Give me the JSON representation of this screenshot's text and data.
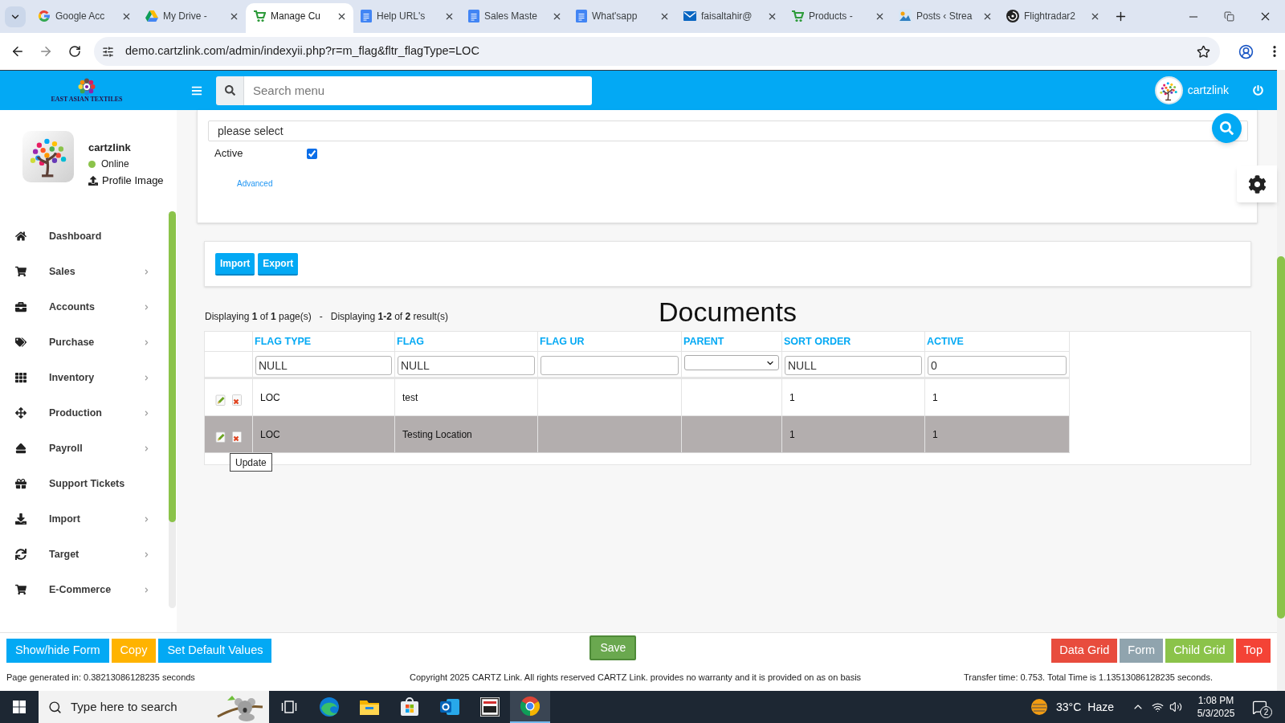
{
  "browser": {
    "tabs": [
      {
        "title": "Google Acc",
        "selected": false
      },
      {
        "title": "My Drive -",
        "selected": false
      },
      {
        "title": "Manage Cu",
        "selected": true
      },
      {
        "title": "Help URL's",
        "selected": false
      },
      {
        "title": "Sales Maste",
        "selected": false
      },
      {
        "title": "What'sapp",
        "selected": false
      },
      {
        "title": "faisaltahir@",
        "selected": false
      },
      {
        "title": "Products -",
        "selected": false
      },
      {
        "title": "Posts ‹ Strea",
        "selected": false
      },
      {
        "title": "Flightradar2",
        "selected": false
      }
    ],
    "address": "demo.cartzlink.com/admin/indexyii.php?r=m_flag&fltr_flagType=LOC"
  },
  "header": {
    "logo_caption": "EAST ASIAN TEXTILES",
    "search": {
      "placeholder": "Search menu"
    },
    "user": "cartzlink"
  },
  "sidebar": {
    "profile": {
      "name": "cartzlink",
      "status": "Online",
      "upload": "Profile Image"
    },
    "items": [
      {
        "label": "Dashboard",
        "has_submenu": false
      },
      {
        "label": "Sales",
        "has_submenu": true
      },
      {
        "label": "Accounts",
        "has_submenu": true
      },
      {
        "label": "Purchase",
        "has_submenu": true
      },
      {
        "label": "Inventory",
        "has_submenu": true
      },
      {
        "label": "Production",
        "has_submenu": true
      },
      {
        "label": "Payroll",
        "has_submenu": true
      },
      {
        "label": "Support Tickets",
        "has_submenu": false
      },
      {
        "label": "Import",
        "has_submenu": true
      },
      {
        "label": "Target",
        "has_submenu": true
      },
      {
        "label": "E-Commerce",
        "has_submenu": true
      }
    ]
  },
  "form": {
    "select": {
      "value": "please select"
    },
    "active": {
      "label": "Active",
      "checked": true
    },
    "advanced_link": "Advanced"
  },
  "toolbar": {
    "buttons": [
      "Import",
      "Export"
    ]
  },
  "grid": {
    "summary": "Displaying **1** of **1** page(s)   -   Displaying **1-2** of **2** result(s)",
    "title": "Documents",
    "columns": [
      {
        "label": "FLAG TYPE",
        "filter": {
          "kind": "text",
          "value": "NULL"
        }
      },
      {
        "label": "FLAG",
        "filter": {
          "kind": "text",
          "value": "NULL"
        }
      },
      {
        "label": "FLAG UR",
        "filter": {
          "kind": "text"
        }
      },
      {
        "label": "PARENT",
        "filter": {
          "kind": "select"
        }
      },
      {
        "label": "SORT ORDER",
        "filter": {
          "kind": "text",
          "value": "NULL"
        }
      },
      {
        "label": "ACTIVE",
        "filter": {
          "kind": "text",
          "value": "0"
        }
      }
    ],
    "rows": [
      {
        "cells": [
          "LOC",
          "test",
          null,
          null,
          "1",
          "1"
        ],
        "highlighted": false
      },
      {
        "cells": [
          "LOC",
          "Testing Location",
          null,
          null,
          "1",
          "1"
        ],
        "highlighted": true,
        "tooltip": "Update"
      }
    ]
  },
  "bottom_bar": {
    "left_buttons": [
      {
        "label": "Show/hide Form",
        "color": "#03a9f4"
      },
      {
        "label": "Copy",
        "color": "#ffb300"
      },
      {
        "label": "Set Default Values",
        "color": "#03a9f4"
      }
    ],
    "save": "Save",
    "right_buttons": [
      {
        "label": "Data Grid",
        "color": "#e84c3d"
      },
      {
        "label": "Form",
        "color": "#90a4ae"
      },
      {
        "label": "Child Grid",
        "color": "#8bc34a"
      },
      {
        "label": "Top",
        "color": "#f44336"
      }
    ]
  },
  "footer": {
    "generated": "Page generated in: 0.38213086128235 seconds",
    "copyright": "Copyright 2025 CARTZ Link. All rights reserved CARTZ Link. provides no warranty and it is provided on as on basis",
    "transfer": "Transfer time: 0.753. Total Time is 1.13513086128235 seconds."
  },
  "taskbar": {
    "search": {
      "placeholder": "Type here to search"
    },
    "apps": [
      {
        "selected": false
      },
      {
        "selected": false
      },
      {
        "selected": false
      },
      {
        "selected": false
      },
      {
        "selected": false
      },
      {
        "selected": false
      },
      {
        "selected": true
      }
    ],
    "weather": {
      "temperature": "33°C",
      "condition": "Haze"
    },
    "time": "1:08 PM",
    "date": "5/3/2025",
    "notifications": "2"
  }
}
